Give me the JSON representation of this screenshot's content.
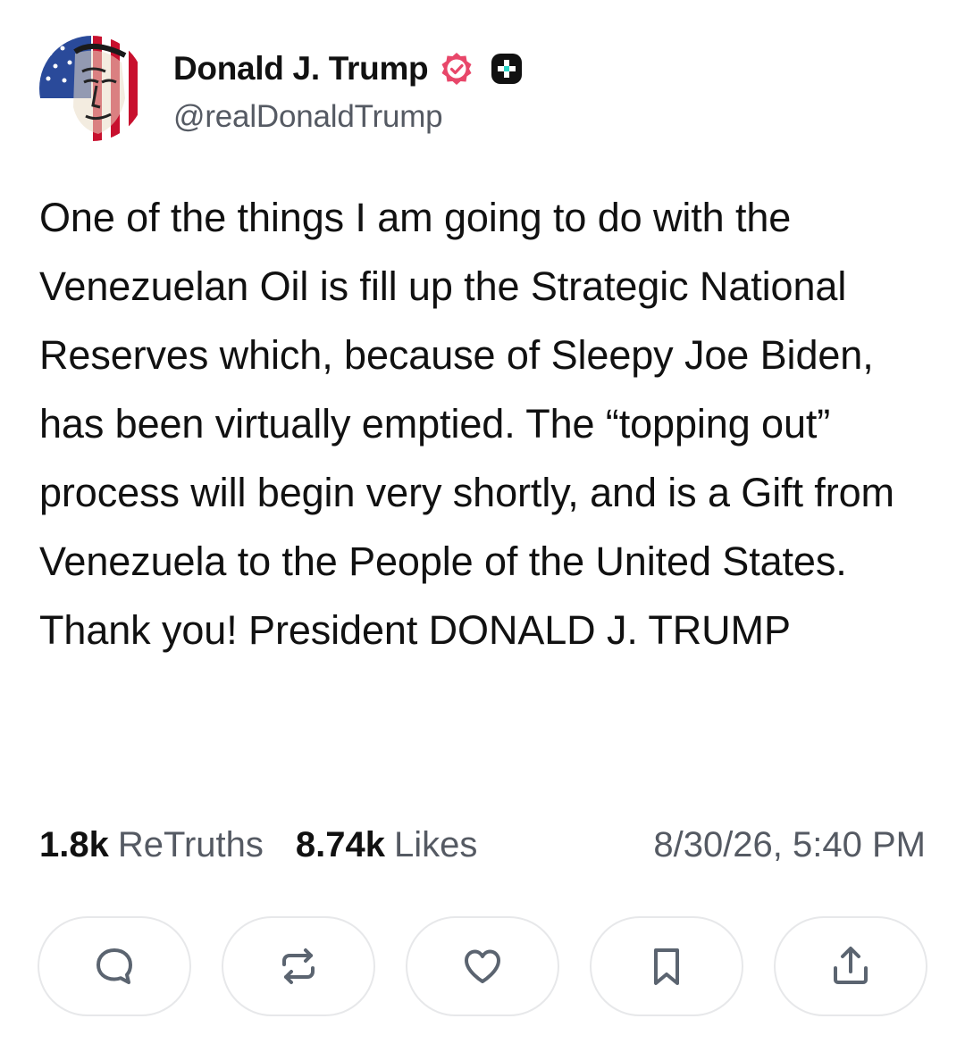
{
  "author": {
    "display_name": "Donald J. Trump",
    "handle": "@realDonaldTrump",
    "avatar_icon": "avatar-flag-portrait",
    "verified_icon": "verified-badge-icon",
    "subscriber_icon": "truth-plus-icon"
  },
  "post": {
    "text": "One of the things I am going to do with the Venezuelan Oil is fill up the Strategic National Reserves which, because of Sleepy Joe Biden, has been virtually emptied. The “topping out” process will begin very shortly, and is a Gift from Venezuela to the People of the United States. Thank you! President DONALD J. TRUMP"
  },
  "stats": {
    "retruths_count": "1.8k",
    "retruths_label": "ReTruths",
    "likes_count": "8.74k",
    "likes_label": "Likes",
    "timestamp": "8/30/26, 5:40 PM"
  },
  "actions": [
    {
      "icon": "reply-icon"
    },
    {
      "icon": "retruth-icon"
    },
    {
      "icon": "like-icon"
    },
    {
      "icon": "bookmark-icon"
    },
    {
      "icon": "share-icon"
    }
  ],
  "colors": {
    "text": "#111111",
    "muted": "#555a63",
    "verified": "#e8476a",
    "icon": "#5b6470",
    "button_border": "#e7e8ea"
  }
}
